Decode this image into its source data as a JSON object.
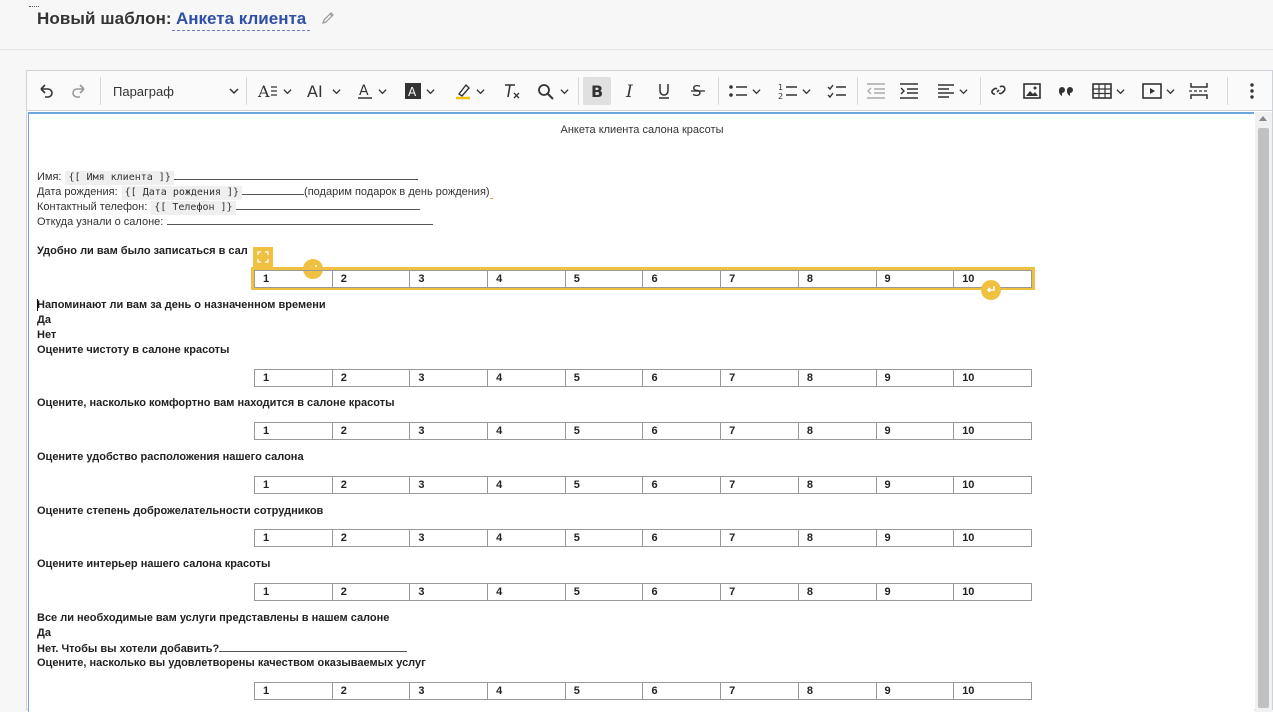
{
  "header": {
    "label": "Новый шаблон:",
    "template_name": "Анкета клиента"
  },
  "toolbar": {
    "paragraph": "Параграф",
    "icons": [
      "undo-icon",
      "redo-icon",
      "font-size-icon",
      "font-family-icon",
      "font-color-icon",
      "background-color-icon",
      "highlight-icon",
      "remove-format-icon",
      "find-replace-icon",
      "bold-icon",
      "italic-icon",
      "underline-icon",
      "strikethrough-icon",
      "bulleted-list-icon",
      "numbered-list-icon",
      "todo-list-icon",
      "outdent-icon",
      "indent-icon",
      "align-icon",
      "link-icon",
      "image-icon",
      "blockquote-icon",
      "table-icon",
      "media-icon",
      "page-break-icon",
      "more-icon"
    ]
  },
  "doc": {
    "title": "Анкета клиента салона красоты",
    "fields": [
      {
        "label": "Имя:",
        "tag": "{[ Имя клиента ]}",
        "suffix": ""
      },
      {
        "label": "Дата рождения:",
        "tag": "{[ Дата рождения ]}",
        "suffix": "(подарим подарок в день рождения)"
      },
      {
        "label": "Контактный телефон:",
        "tag": "{[ Телефон ]}",
        "suffix": ""
      },
      {
        "label": "Откуда узнали о салоне:",
        "tag": "",
        "suffix": ""
      }
    ],
    "q1": "Удобно ли вам было записаться в сал",
    "q2": "Напоминают ли вам за день о назначенном времени",
    "q2_yes": "Да",
    "q2_no": "Нет",
    "q3": "Оцените чистоту в салоне красоты",
    "q4": "Оцените, насколько комфортно вам находится в салоне красоты",
    "q5": "Оцените удобство расположения нашего салона",
    "q6": "Оцените степень доброжелательности сотрудников",
    "q7": "Оцените интерьер нашего салона красоты",
    "q8": "Все ли необходимые вам услуги представлены в нашем салоне",
    "q8_yes": "Да",
    "q8_no": "Нет. Чтобы вы хотели добавить?",
    "q9": "Оцените, насколько вы удовлетворены качеством оказываемых услуг",
    "scale": [
      "1",
      "2",
      "3",
      "4",
      "5",
      "6",
      "7",
      "8",
      "9",
      "10"
    ]
  },
  "colors": {
    "accent": "#2f4fa8",
    "selection": "#f0c040",
    "focus": "#6aa7e0"
  }
}
